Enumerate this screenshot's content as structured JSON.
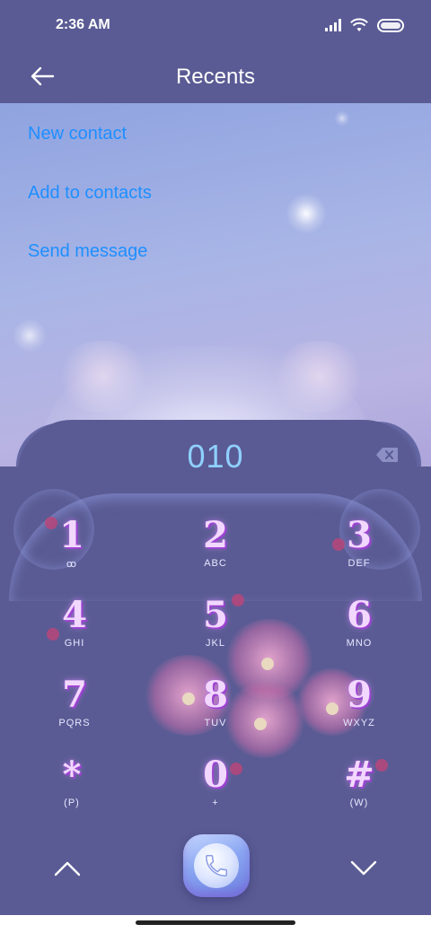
{
  "status_bar": {
    "time": "2:36 AM"
  },
  "header": {
    "title": "Recents",
    "back_icon": "arrow-left-icon"
  },
  "menu": [
    {
      "label": "New contact"
    },
    {
      "label": "Add to contacts"
    },
    {
      "label": "Send message"
    }
  ],
  "dialer": {
    "number": "010",
    "keys": [
      {
        "digit": "1",
        "letters": "ꝏ"
      },
      {
        "digit": "2",
        "letters": "ABC"
      },
      {
        "digit": "3",
        "letters": "DEF"
      },
      {
        "digit": "4",
        "letters": "GHI"
      },
      {
        "digit": "5",
        "letters": "JKL"
      },
      {
        "digit": "6",
        "letters": "MNO"
      },
      {
        "digit": "7",
        "letters": "PQRS"
      },
      {
        "digit": "8",
        "letters": "TUV"
      },
      {
        "digit": "9",
        "letters": "WXYZ"
      },
      {
        "digit": "*",
        "letters": "(P)"
      },
      {
        "digit": "0",
        "letters": "+"
      },
      {
        "digit": "#",
        "letters": "(W)"
      }
    ]
  },
  "controls": {
    "up_icon": "chevron-up-icon",
    "call_icon": "phone-icon",
    "down_icon": "chevron-down-icon"
  },
  "colors": {
    "bar": "#5a5b94",
    "link": "#1e8fff",
    "number": "#8fd0ff"
  }
}
